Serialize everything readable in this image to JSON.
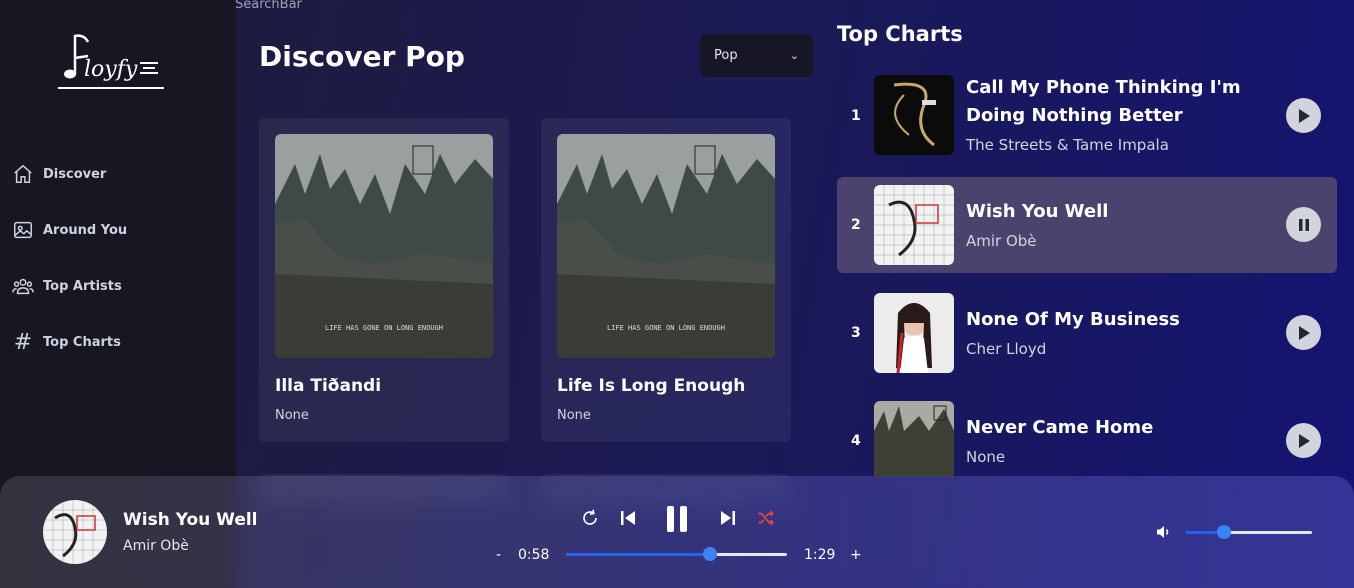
{
  "search": {
    "label": "SearchBar"
  },
  "brand": {
    "logo_text": "floyfy"
  },
  "sidebar": {
    "items": [
      {
        "label": "Discover",
        "icon": "home-icon"
      },
      {
        "label": "Around You",
        "icon": "image-icon"
      },
      {
        "label": "Top Artists",
        "icon": "users-icon"
      },
      {
        "label": "Top Charts",
        "icon": "hash-icon"
      }
    ]
  },
  "discover": {
    "title": "Discover Pop",
    "genre_selected": "Pop",
    "cards": [
      {
        "title": "Illa Tiðandi",
        "artist": "None"
      },
      {
        "title": "Life Is Long Enough",
        "artist": "None"
      }
    ]
  },
  "top_charts": {
    "heading": "Top Charts",
    "items": [
      {
        "rank": "1",
        "title": "Call My Phone Thinking I'm Doing Nothing Better",
        "artist": "The Streets & Tame Impala",
        "state": "play"
      },
      {
        "rank": "2",
        "title": "Wish You Well",
        "artist": "Amir Obè",
        "state": "pause"
      },
      {
        "rank": "3",
        "title": "None Of My Business",
        "artist": "Cher Lloyd",
        "state": "play"
      },
      {
        "rank": "4",
        "title": "Never Came Home",
        "artist": "None",
        "state": "play"
      }
    ]
  },
  "player": {
    "title": "Wish You Well",
    "artist": "Amir Obè",
    "minus": "-",
    "plus": "+",
    "current_time": "0:58",
    "duration": "1:29",
    "progress": 0.65,
    "volume": 0.3
  },
  "colors": {
    "accent": "#3b82f6",
    "shuffle_active": "#ef4444",
    "active_row": "#4c426e"
  }
}
